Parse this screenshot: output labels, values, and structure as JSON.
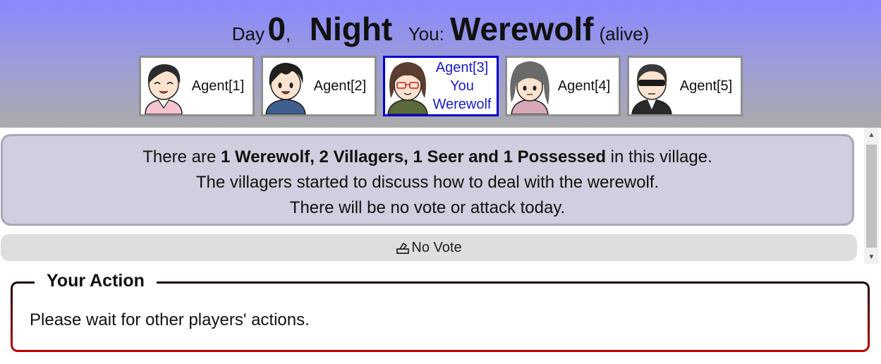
{
  "header": {
    "day_label": "Day",
    "day_number": "0",
    "comma": ",",
    "phase": "Night",
    "you_label": "You:",
    "role": "Werewolf",
    "status": "(alive)"
  },
  "agents": [
    {
      "name": "Agent[1]",
      "avatar": "smiling-girl-avatar"
    },
    {
      "name": "Agent[2]",
      "avatar": "smiling-boy-avatar"
    },
    {
      "name": "Agent[3]",
      "you": "You",
      "role": "Werewolf",
      "avatar": "woman-with-glasses-avatar",
      "selected": true
    },
    {
      "name": "Agent[4]",
      "avatar": "gray-haired-girl-avatar"
    },
    {
      "name": "Agent[5]",
      "avatar": "man-with-sunglasses-avatar"
    }
  ],
  "message": {
    "line1_pre": "There are ",
    "line1_bold": "1 Werewolf, 2 Villagers, 1 Seer and 1 Possessed",
    "line1_post": " in this village.",
    "line2": "The villagers started to discuss how to deal with the werewolf.",
    "line3": "There will be no vote or attack today."
  },
  "vote": {
    "icon": "ballot-box-icon",
    "label": "No Vote"
  },
  "action": {
    "legend": "Your Action",
    "text": "Please wait for other players' actions."
  },
  "colors": {
    "header_top": "#8888ff",
    "header_bottom": "#ababab",
    "selected_border": "#0000cc",
    "selected_text": "#1a1acc",
    "message_bg": "#cfcfdf",
    "action_border": "#c00000"
  }
}
